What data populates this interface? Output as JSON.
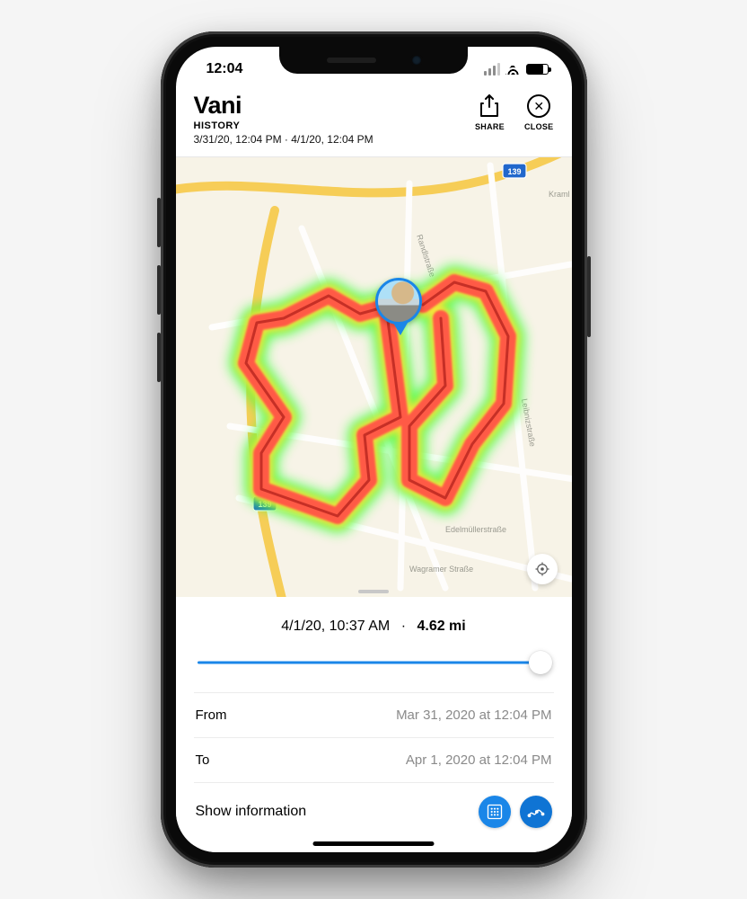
{
  "status": {
    "time": "12:04"
  },
  "header": {
    "title": "Vani",
    "section": "HISTORY",
    "range": "3/31/20, 12:04 PM  ·  4/1/20, 12:04 PM",
    "share_label": "SHARE",
    "close_label": "CLOSE"
  },
  "map": {
    "route_shield": "139",
    "street_labels": [
      "Randlstraße",
      "Leibnizstraße",
      "Edelmüllerstraße",
      "Wagramer Straße",
      "Kraml"
    ],
    "pin_subject": "Vani"
  },
  "summary": {
    "timestamp": "4/1/20, 10:37 AM",
    "distance": "4.62 mi"
  },
  "range_picker": {
    "from_label": "From",
    "from_value": "Mar 31, 2020 at 12:04 PM",
    "to_label": "To",
    "to_value": "Apr 1, 2020 at 12:04 PM"
  },
  "footer": {
    "info_label": "Show information"
  },
  "colors": {
    "accent": "#1a86e8"
  }
}
